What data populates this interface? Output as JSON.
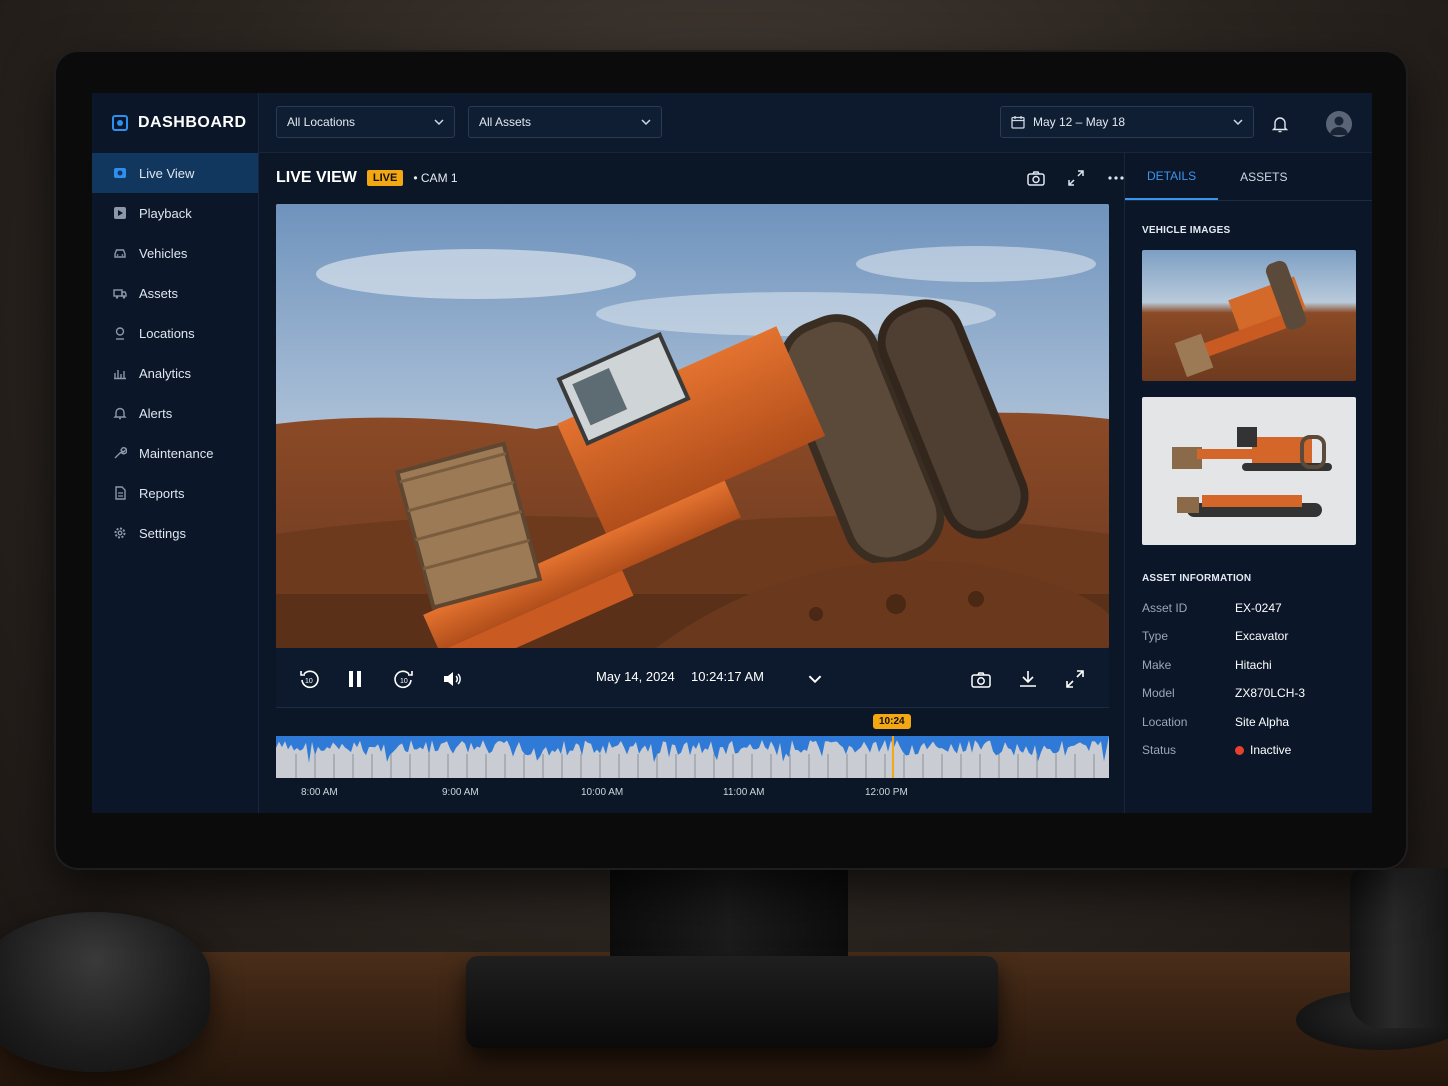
{
  "colors": {
    "accent": "#2f8ff0",
    "live": "#f3a712",
    "inactive": "#e8402f"
  },
  "brand": {
    "title": "DASHBOARD"
  },
  "sidebar": {
    "items": [
      {
        "label": "Live View",
        "icon": "video-icon"
      },
      {
        "label": "Playback",
        "icon": "play-icon"
      },
      {
        "label": "Vehicles",
        "icon": "car-icon"
      },
      {
        "label": "Assets",
        "icon": "truck-icon"
      },
      {
        "label": "Locations",
        "icon": "pin-icon"
      },
      {
        "label": "Analytics",
        "icon": "chart-icon"
      },
      {
        "label": "Alerts",
        "icon": "bell-icon"
      },
      {
        "label": "Maintenance",
        "icon": "wrench-icon"
      },
      {
        "label": "Reports",
        "icon": "document-icon"
      },
      {
        "label": "Settings",
        "icon": "gear-icon"
      }
    ]
  },
  "topbar": {
    "location_filter": "All Locations",
    "asset_filter": "All Assets",
    "date_range": "May 12 – May 18"
  },
  "main": {
    "title": "LIVE VIEW",
    "live_badge": "LIVE",
    "camera": "• CAM 1",
    "playback": {
      "date": "May 14, 2024",
      "time": "10:24:17 AM"
    },
    "timeline": {
      "marker": "10:24",
      "ticks": [
        "8:00 AM",
        "9:00 AM",
        "10:00 AM",
        "11:00 AM",
        "12:00 PM"
      ]
    }
  },
  "panel": {
    "tabs": [
      "DETAILS",
      "ASSETS"
    ],
    "vehicle_images_title": "VEHICLE IMAGES",
    "asset_info_title": "ASSET INFORMATION",
    "info": [
      {
        "label": "Asset ID",
        "value": "EX-0247"
      },
      {
        "label": "Type",
        "value": "Excavator"
      },
      {
        "label": "Make",
        "value": "Hitachi"
      },
      {
        "label": "Model",
        "value": "ZX870LCH-3"
      },
      {
        "label": "Location",
        "value": "Site Alpha"
      },
      {
        "label": "Status",
        "value": "Inactive"
      }
    ]
  }
}
